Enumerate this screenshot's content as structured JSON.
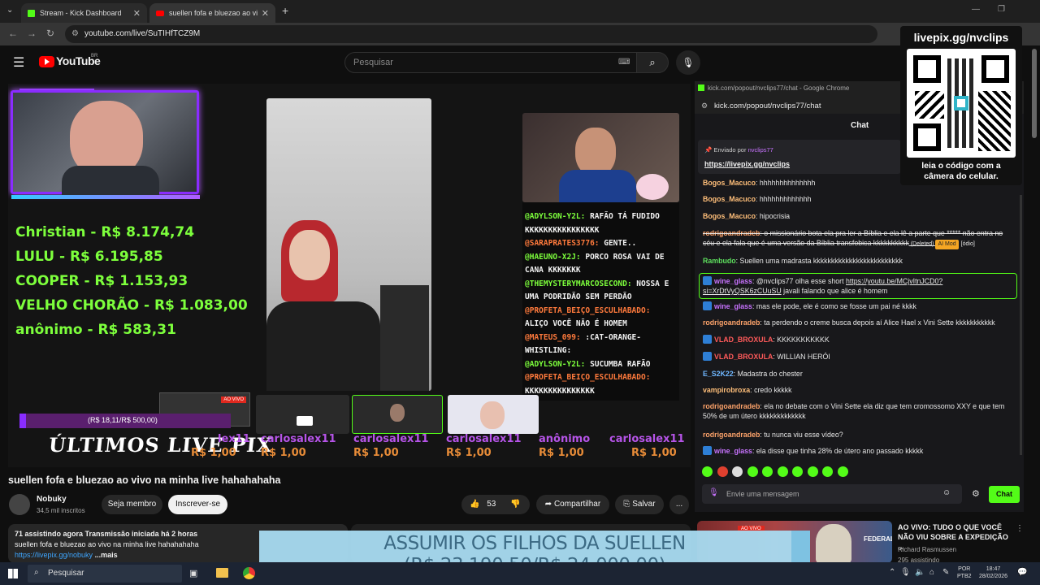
{
  "browser": {
    "tabs": [
      {
        "title": "Stream - Kick Dashboard"
      },
      {
        "title": "suellen fofa e bluezao ao vi"
      }
    ],
    "new_tab": "+",
    "url": "youtube.com/live/SuTIHfTCZ9M"
  },
  "youtube": {
    "logo": "YouTube",
    "region": "BR",
    "search_placeholder": "Pesquisar"
  },
  "video": {
    "overlay_tag": "livepix.gg/nvclips",
    "donors": [
      "Christian - R$ 8.174,74",
      "LULU - R$ 6.195,85",
      "COOPER - R$ 1.153,93",
      "VELHO CHORÃO - R$ 1.083,00",
      "anônimo - R$ 583,31"
    ],
    "goal_small": "(R$ 18,11/R$ 500,00)",
    "ultimos": "ÚLTIMOS LIVE PIX",
    "ao_vivo": "AO VIVO",
    "livepix_names": [
      "lex11",
      "carlosalex11",
      "carlosalex11",
      "carlosalex11",
      "anônimo",
      "carlosalex11"
    ],
    "livepix_values": [
      "R$ 1,00",
      "R$ 1,00",
      "R$ 1,00",
      "R$ 1,00",
      "R$ 1,00",
      "R$ 1,00"
    ],
    "stream_chat": [
      {
        "user": "@ADYLSON-Y2L:",
        "msg": " RAFÃO TÁ FUDIDO KKKKKKKKKKKKKKKK",
        "c": "u"
      },
      {
        "user": "@SARAPRATES3776:",
        "msg": " GENTE..",
        "c": "r"
      },
      {
        "user": "@HAEUNO-X2J:",
        "msg": " PORCO ROSA VAI DE CANA KKKKKKK",
        "c": "u"
      },
      {
        "user": "@THEMYSTERYMARCOSECOND:",
        "msg": " NOSSA E UMA PODRIDÃO SEM PERDÃO",
        "c": "u"
      },
      {
        "user": "@PROFETA_BEIÇO_ESCULHABADO:",
        "msg": " ALIÇO VOCÊ NÃO É HOMEM",
        "c": "r"
      },
      {
        "user": "@MATEUS_099:",
        "msg": " :CAT-ORANGE-WHISTLING:",
        "c": "r"
      },
      {
        "user": "@ADYLSON-Y2L:",
        "msg": " SUCUMBA RAFÃO",
        "c": "u"
      },
      {
        "user": "@PROFETA_BEIÇO_ESCULHABADO:",
        "msg": " KKKKKKKKKKKKKKK",
        "c": "r"
      }
    ]
  },
  "below": {
    "title": "suellen fofa e bluezao ao vivo na minha live hahahahaha",
    "channel": "Nobuky",
    "subs": "34,5 mil inscritos",
    "member": "Seja membro",
    "subscribe": "Inscrever-se",
    "likes": "53",
    "share": "Compartilhar",
    "save": "Salvar",
    "more": "...",
    "desc_line1": "71 assistindo agora  Transmissão iniciada há 2 horas",
    "desc_line2": "suellen fofa e bluezao ao vivo na minha live hahahahaha",
    "desc_link": "https://livepix.gg/nobuky",
    "desc_more": "...mais"
  },
  "popout": {
    "window_title": "kick.com/popout/nvclips77/chat - Google Chrome",
    "url": "kick.com/popout/nvclips77/chat",
    "chat_label": "Chat",
    "pinned_by": "Enviado por",
    "pinned_user": "nvclips77",
    "pinned_link": "https://livepix.gg/nvclips",
    "messages": [
      {
        "user": "Bogos_Macuco",
        "text": "hhhhhhhhhhhhhh",
        "c": "y"
      },
      {
        "user": "Bogos_Macuco",
        "text": "hhhhhhhhhhhhh",
        "c": "y"
      },
      {
        "user": "Bogos_Macuco",
        "text": "hipocrisia",
        "c": "y"
      },
      {
        "user": "rodrigoandradeb",
        "text": "o missionário bota ela pra ler a Bíblia e ela lê a parte que ***** não entra no céu e ela fala que é uma versão da Bíblia transfobica kkkkkkkkkk",
        "c": "",
        "deleted": "(Deleted)",
        "mod": "AI Mod",
        "tag": "[ódio]"
      },
      {
        "user": "Rambudo",
        "text": "Suellen uma madrasta kkkkkkkkkkkkkkkkkkkkkkkkk",
        "c": "g"
      },
      {
        "user": "wine_glass",
        "text": "@nvclips77 olha esse short ",
        "link": "https://youtu.be/MCjvItnJCD0?si=XrDtVyQSK6zCUuSU",
        "text2": " javali falando que alice é homem",
        "c": "p"
      },
      {
        "user": "wine_glass",
        "text": "mas ele pode, ele é como se fosse um pai né kkkk",
        "c": "p"
      },
      {
        "user": "rodrigoandradeb",
        "text": "ta perdendo o creme busca depois aí Alice Hael x Vini Sette kkkkkkkkkkk",
        "c": ""
      },
      {
        "user": "VLAD_BROXULA",
        "text": "KKKKKKKKKKK",
        "c": "rd"
      },
      {
        "user": "VLAD_BROXULA",
        "text": "WILLIAN HERÓI",
        "c": "rd"
      },
      {
        "user": "E_S2K22",
        "text": "Madastra do chester",
        "c": "b"
      },
      {
        "user": "vampirobroxa",
        "text": "credo kkkkk",
        "c": "y"
      },
      {
        "user": "rodrigoandradeb",
        "text": "ela no debate com o Vini Sette ela diz que tem cromossomo XXY e que tem 50% de um útero kkkkkkkkkkkkk",
        "c": ""
      },
      {
        "user": "rodrigoandradeb",
        "text": "tu nunca viu esse vídeo?",
        "c": ""
      },
      {
        "user": "wine_glass",
        "text": "ela disse que tinha 28% de útero ano passado kkkkk",
        "c": "p"
      }
    ],
    "input_placeholder": "Envie uma mensagem",
    "send": "Chat"
  },
  "qr": {
    "title": "livepix.gg/nvclips",
    "caption1": "leia o código com a",
    "caption2": "câmera do celular."
  },
  "recommended": {
    "live_badge": "AO VIVO",
    "thumb_text": "FEDERAL",
    "title": "AO VIVO: TUDO O QUE VOCÊ NÃO VIU SOBRE A EXPEDIÇÃO ...",
    "channel": "Richard Rasmussen",
    "watching": "295 assistindo"
  },
  "banner": {
    "line1": "ASSUMIR OS FILHOS DA SUELLEN",
    "line2": "(R$ 23.190,50/R$ 24.000,00)",
    "progress": 0.9663
  },
  "taskbar": {
    "search": "Pesquisar",
    "lang1": "POR",
    "lang2": "PTB2",
    "time": "18:47",
    "date": "28/02/2026"
  },
  "colors": {
    "accent_green": "#53fc18",
    "youtube_red": "#ff0000",
    "donor_green": "#7dff3c",
    "banner_blue": "#7ec9ea"
  }
}
